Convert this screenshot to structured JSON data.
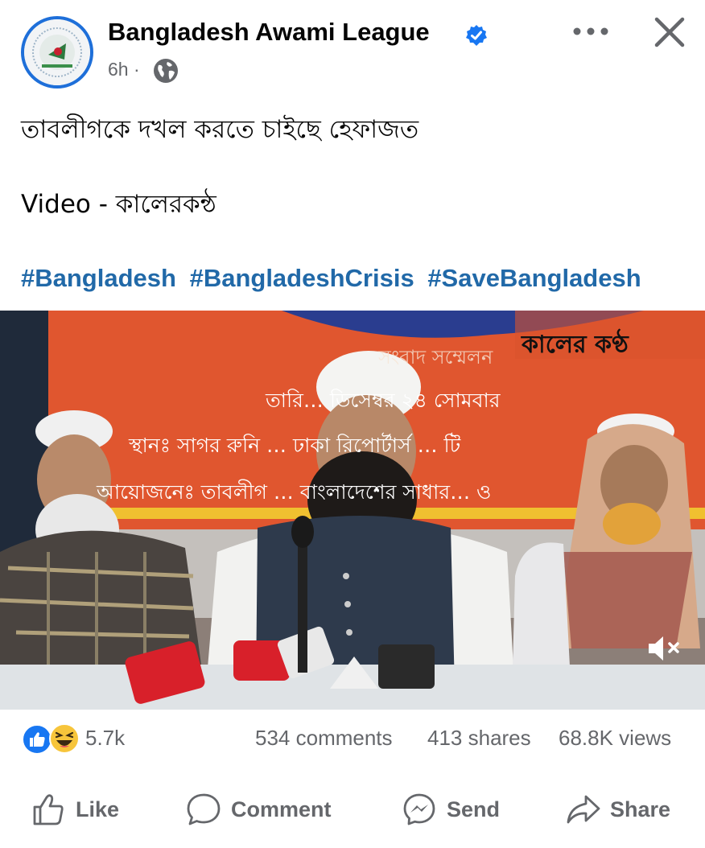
{
  "post": {
    "page_name": "Bangladesh Awami League",
    "time": "6h ·",
    "text_line1": "তাবলীগকে দখল করতে চাইছে হেফাজত",
    "text_line2": "Video - কালেরকন্ঠ",
    "hashtags": [
      "#Bangladesh",
      "#BangladeshCrisis",
      "#SaveBangladesh"
    ]
  },
  "video": {
    "watermark": "কালের কণ্ঠ",
    "banner_lines": [
      "সংবাদ সম্মেলন",
      "তারি… ডিসেম্বর ২৪ সোমবার",
      "স্থানঃ সাগর রুনি … ঢাকা রিপোর্টার্স … টি",
      "আয়োজনেঃ তাবলীগ … বাংলাদেশের সাধার… ও"
    ],
    "mute_icon": "muted-speaker-icon"
  },
  "stats": {
    "reactions_count": "5.7k",
    "comments": "534 comments",
    "shares": "413 shares",
    "views": "68.8K views"
  },
  "actions": {
    "like": "Like",
    "comment": "Comment",
    "send": "Send",
    "share": "Share"
  },
  "colors": {
    "verified": "#1877f2",
    "hashtag": "#2169a8",
    "avatar_ring": "#1e6fd9",
    "banner": "#e0562f"
  }
}
